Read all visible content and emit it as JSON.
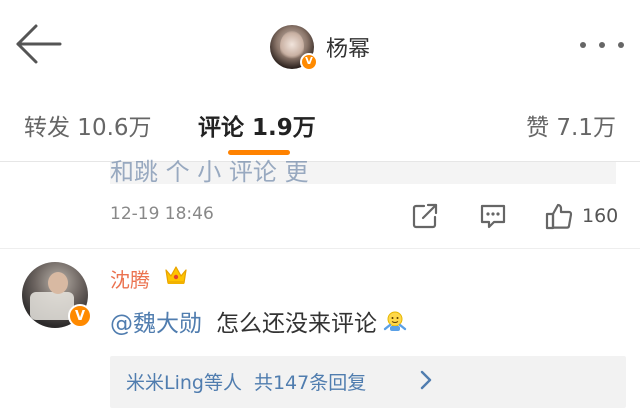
{
  "header": {
    "username": "杨幂",
    "verified_badge": "V",
    "back_icon": "arrow-left-icon",
    "more_icon": "more-dots-icon"
  },
  "tabs": [
    {
      "label": "转发 10.6万",
      "active": false
    },
    {
      "label": "评论 1.9万",
      "active": true
    },
    {
      "label": "赞 7.1万",
      "active": false
    }
  ],
  "accent_color": "#ff8200",
  "previous_comment": {
    "snippet_text": "和跳 个 小 评论 更",
    "timestamp": "12-19 18:46",
    "actions": {
      "share_icon": "share-icon",
      "comment_icon": "comment-icon",
      "like_icon": "thumbs-up-icon",
      "like_count": "160"
    }
  },
  "comment": {
    "author": "沈腾",
    "verified_badge": "V",
    "crown_icon": "crown-icon",
    "mention": "@魏大勋",
    "text": "怎么还没来评论",
    "emoji_icon": "shrug-emoji-icon",
    "replies": {
      "people": "米米Ling等人",
      "count_label": "共147条回复",
      "chevron_icon": "chevron-right-icon"
    }
  }
}
